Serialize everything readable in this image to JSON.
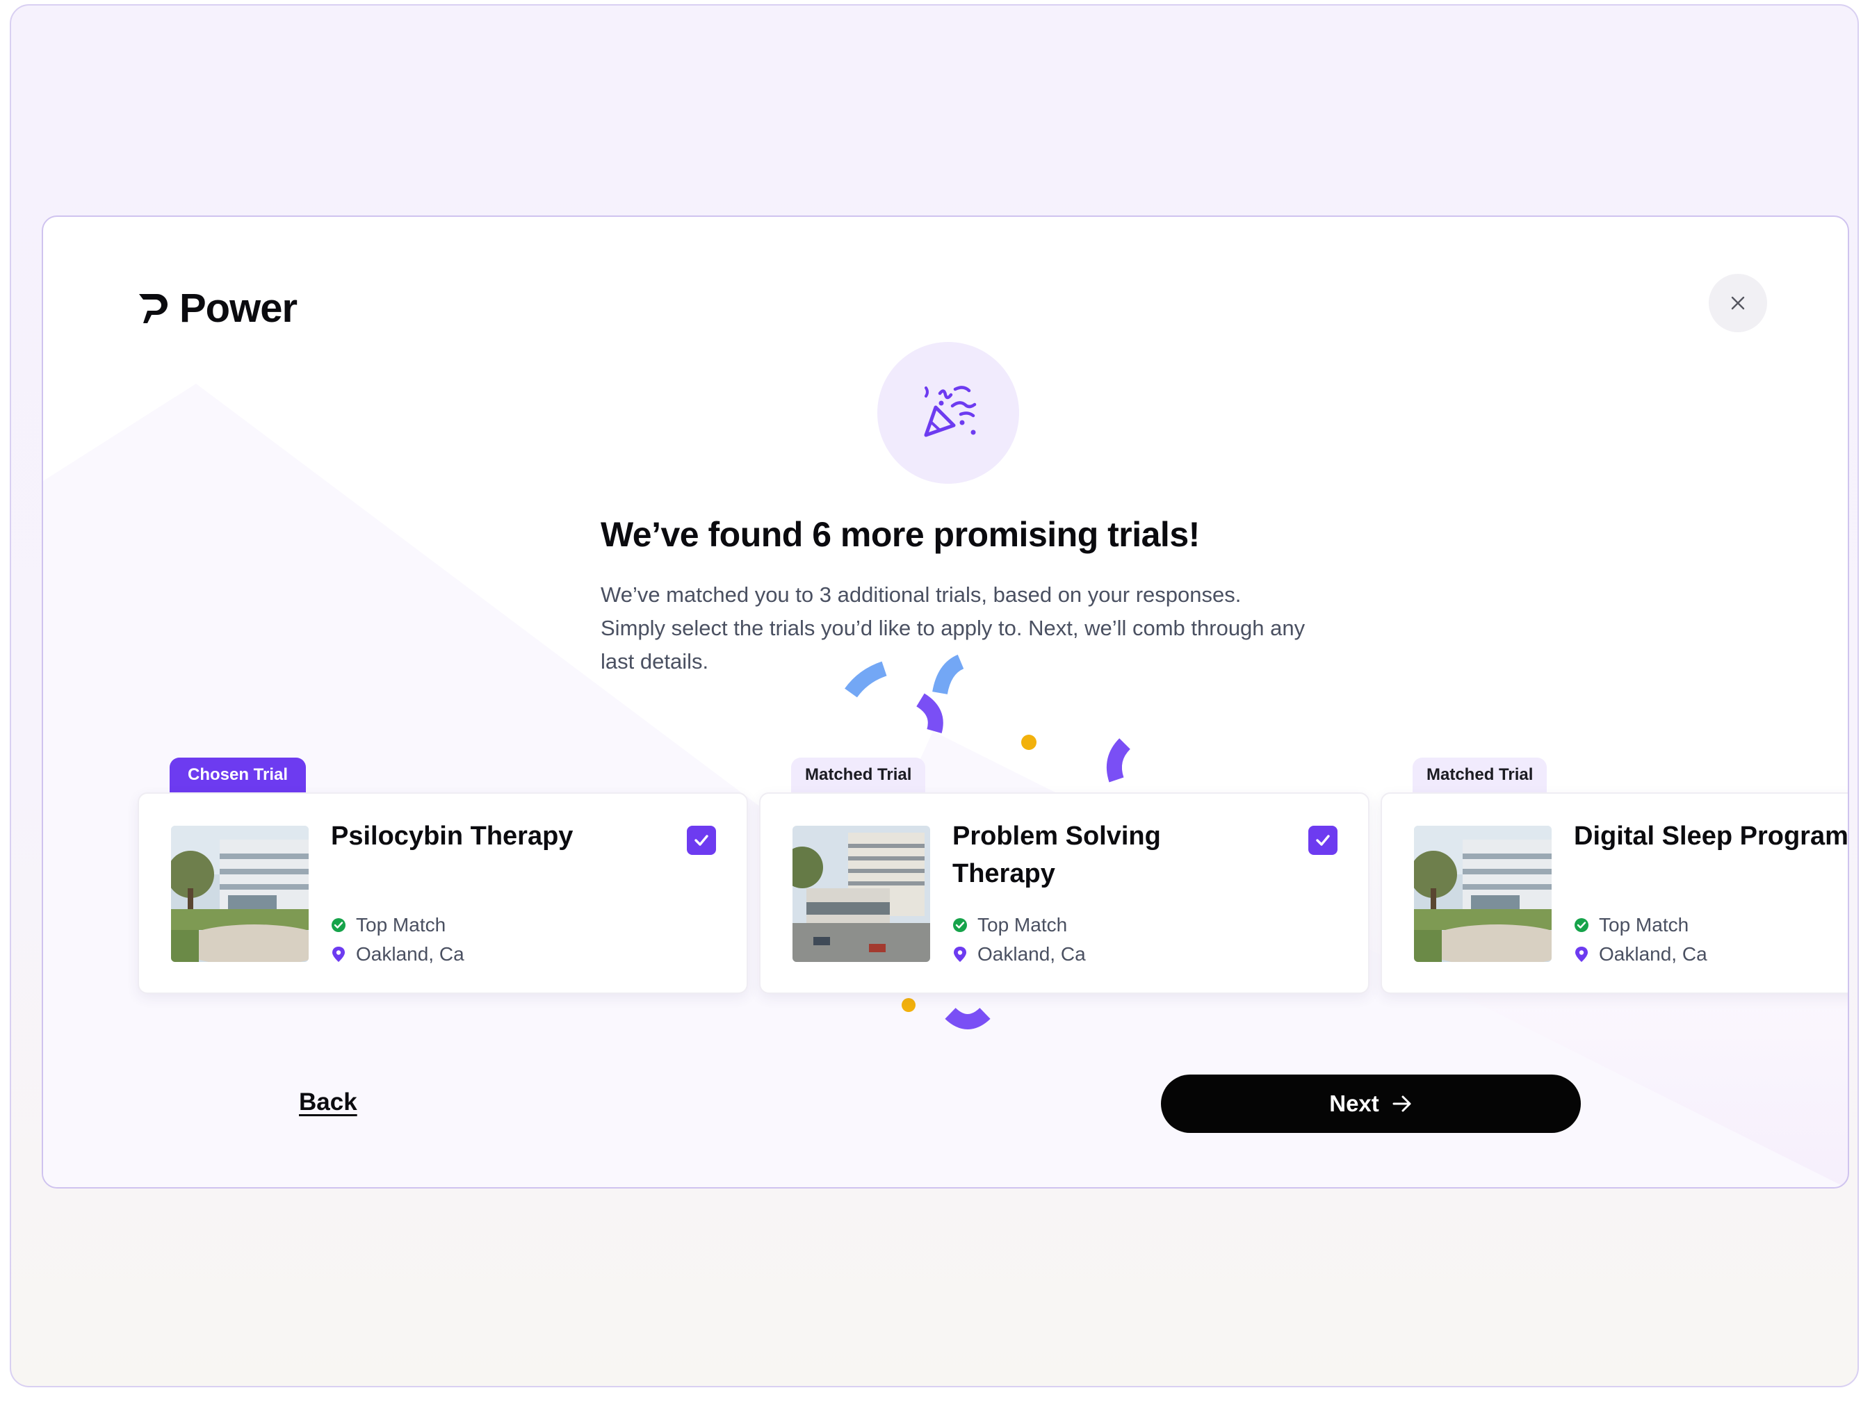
{
  "brand": {
    "name": "Power"
  },
  "header": {
    "close_icon": "close-icon"
  },
  "hero": {
    "icon": "party-popper-icon",
    "title": "We’ve found 6 more promising trials!",
    "subtitle": "We’ve matched you to 3 additional trials, based on your responses. Simply select the trials you’d like to apply to. Next, we’ll comb through any last details."
  },
  "trials": [
    {
      "tag": "Chosen Trial",
      "tag_type": "chosen",
      "title": "Psilocybin Therapy",
      "match": "Top Match",
      "location": "Oakland, Ca",
      "selected": true
    },
    {
      "tag": "Matched Trial",
      "tag_type": "matched",
      "title": "Problem Solving Therapy",
      "match": "Top Match",
      "location": "Oakland, Ca",
      "selected": true
    },
    {
      "tag": "Matched Trial",
      "tag_type": "matched",
      "title": "Digital Sleep Programs",
      "match": "Top Match",
      "location": "Oakland, Ca",
      "selected": false
    }
  ],
  "footer": {
    "back_label": "Back",
    "next_label": "Next"
  },
  "colors": {
    "accent": "#6d3bf0",
    "success": "#16a34a",
    "confetti_blue": "#73a7f5",
    "confetti_yellow": "#f2b10c"
  }
}
